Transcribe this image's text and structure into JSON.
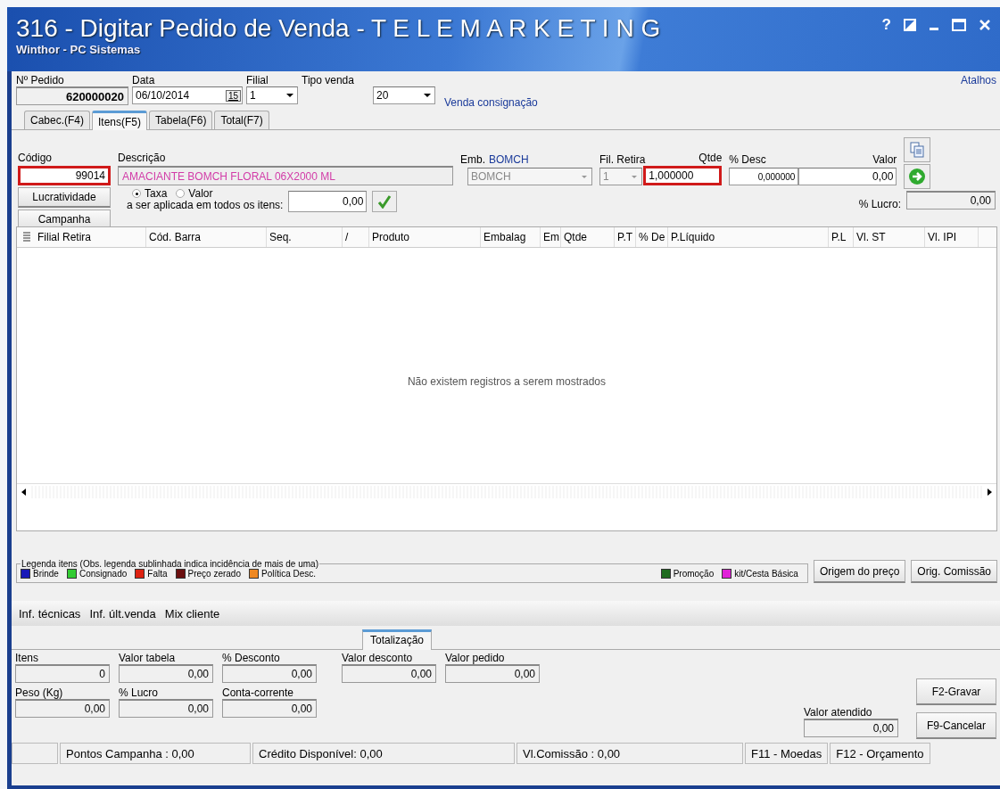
{
  "window": {
    "title": "316 - Digitar Pedido de Venda - T E L E M A R K E T I N G",
    "subtitle": "Winthor - PC Sistemas",
    "controls": [
      "?"
    ]
  },
  "header": {
    "shortcuts_link": "Atalhos",
    "fields": [
      {
        "kind": "text",
        "label": "Nº Pedido",
        "value": "620000020"
      },
      {
        "kind": "date",
        "label": "Data",
        "value": "06/10/2014",
        "calendar": "15"
      },
      {
        "kind": "combo",
        "label": "Filial",
        "value": "1"
      },
      {
        "kind": "combo",
        "label": "Tipo venda",
        "value": "20"
      }
    ],
    "sale_type_text": "Venda consignação"
  },
  "tabs": [
    {
      "label": "Cabec.(F4)",
      "selected": false
    },
    {
      "label": "Itens(F5)",
      "selected": true
    },
    {
      "label": "Tabela(F6)",
      "selected": false
    },
    {
      "label": "Total(F7)",
      "selected": false
    }
  ],
  "item_entry": {
    "codigo": {
      "label": "Código",
      "value": "99014",
      "highlighted": true
    },
    "descricao": {
      "label": "Descrição",
      "value": "AMACIANTE BOMCH FLORAL 06X2000 ML"
    },
    "emb": {
      "label": "Emb.",
      "label_value": "BOMCH",
      "value": "BOMCH",
      "disabled": true
    },
    "fil_retira": {
      "label": "Fil. Retira",
      "value": "1",
      "disabled": true
    },
    "qtde": {
      "label": "Qtde",
      "value": "1,000000",
      "highlighted": true
    },
    "desc": {
      "label": "% Desc",
      "value": "0,000000"
    },
    "valor": {
      "label": "Valor",
      "value": "0,00"
    },
    "lucro": {
      "label": "% Lucro:",
      "value": "0,00"
    },
    "buttons": [
      "Lucratividade",
      "Campanha"
    ],
    "rate_options": [
      {
        "label": "Taxa",
        "selected": true
      },
      {
        "label": "Valor",
        "selected": false
      }
    ],
    "rate_caption": "a ser aplicada em todos os itens:",
    "rate_value": "0,00"
  },
  "table": {
    "columns": [
      "Filial Retira",
      "Cód. Barra",
      "Seq.",
      "/",
      "Produto",
      "Embalag",
      "Em",
      "Qtde",
      "P.T",
      "% De",
      "P.Líquido",
      "P.L",
      "Vl. ST",
      "Vl. IPI"
    ],
    "empty_message": "Não existem registros a serem mostrados"
  },
  "legend": {
    "title": "Legenda itens (Obs. legenda sublinhada indica incidência de mais de uma)",
    "items": [
      {
        "label": "Brinde",
        "color": "#1a1ab8"
      },
      {
        "label": "Consignado",
        "color": "#33cc33"
      },
      {
        "label": "Falta",
        "color": "#dd2211"
      },
      {
        "label": "Preço zerado",
        "color": "#6b0f0f"
      },
      {
        "label": "Política Desc.",
        "color": "#ee8822"
      },
      {
        "label": "Promoção",
        "color": "#1e6b1e"
      },
      {
        "label": "kit/Cesta Básica",
        "color": "#e020d8"
      }
    ]
  },
  "legend_buttons": [
    "Origem do preço",
    "Orig. Comissão"
  ],
  "info_links": [
    "Inf. técnicas",
    "Inf. últ.venda",
    "Mix cliente"
  ],
  "totals": {
    "tab": {
      "label": "Totalização",
      "selected": true
    },
    "rows": [
      [
        {
          "label": "Itens",
          "value": "0"
        },
        {
          "label": "Valor tabela",
          "value": "0,00"
        },
        {
          "label": "% Desconto",
          "value": "0,00"
        },
        {
          "label": "Valor desconto",
          "value": "0,00"
        },
        {
          "label": "Valor pedido",
          "value": "0,00"
        }
      ],
      [
        {
          "label": "Peso (Kg)",
          "value": "0,00"
        },
        {
          "label": "% Lucro",
          "value": "0,00"
        },
        {
          "label": "Conta-corrente",
          "value": "0,00"
        }
      ]
    ],
    "valor_atendido": {
      "label": "Valor atendido",
      "value": "0,00"
    },
    "buttons": [
      "F2-Gravar",
      "F9-Cancelar"
    ]
  },
  "status_bar": [
    "Pontos Campanha : 0,00",
    "Crédito Disponível: 0,00",
    "Vl.Comissão : 0,00",
    "F11 - Moedas",
    "F12 - Orçamento"
  ]
}
